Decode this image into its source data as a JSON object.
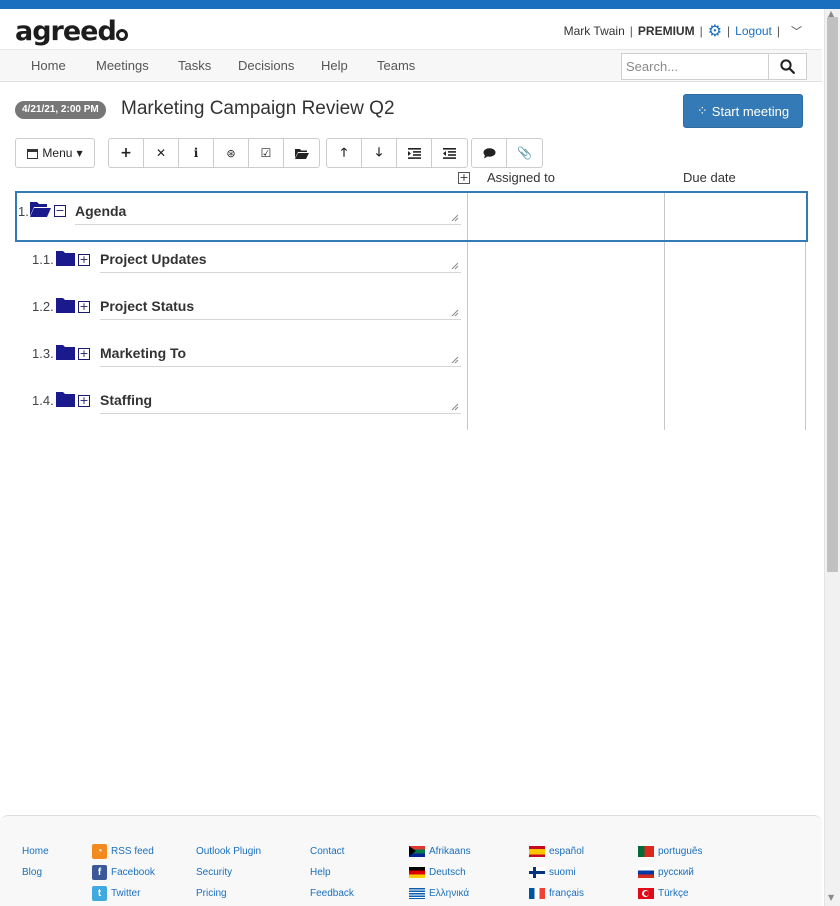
{
  "brand": {
    "logo_text_a": "agreed",
    "logo_text_b": ""
  },
  "user": {
    "name": "Mark Twain",
    "plan": "PREMIUM",
    "logout_label": "Logout",
    "sep": "|"
  },
  "nav": {
    "items": [
      "Home",
      "Meetings",
      "Tasks",
      "Decisions",
      "Help",
      "Teams"
    ],
    "search_placeholder": "Search..."
  },
  "meeting": {
    "date_badge": "4/21/21, 2:00 PM",
    "title": "Marketing Campaign Review Q2",
    "start_label": "Start meeting"
  },
  "toolbar": {
    "menu_label": "Menu"
  },
  "columns": {
    "assigned_to": "Assigned to",
    "due_date": "Due date"
  },
  "agenda": [
    {
      "num": "1.",
      "title": "Agenda",
      "expander": "−",
      "open": true
    },
    {
      "num": "1.1.",
      "title": "Project Updates",
      "expander": "+"
    },
    {
      "num": "1.2.",
      "title": "Project Status",
      "expander": "+"
    },
    {
      "num": "1.3.",
      "title": "Marketing To",
      "expander": "+"
    },
    {
      "num": "1.4.",
      "title": "Staffing",
      "expander": "+"
    }
  ],
  "footer": {
    "col1": [
      "Home",
      "Blog"
    ],
    "col2": [
      "RSS feed",
      "Facebook",
      "Twitter"
    ],
    "col3": [
      "Outlook Plugin",
      "Security",
      "Pricing"
    ],
    "col4": [
      "Contact",
      "Help",
      "Feedback"
    ],
    "col5": [
      "Afrikaans",
      "Deutsch",
      "Ελληνικά"
    ],
    "col6": [
      "español",
      "suomi",
      "français"
    ],
    "col7": [
      "português",
      "русский",
      "Türkçe"
    ]
  },
  "colors": {
    "accent": "#1a6fbf",
    "button": "#337ab7",
    "folder": "#1a1a8c"
  },
  "icons": [
    "gear-icon",
    "search-icon",
    "spinner-icon",
    "calendar-icon",
    "plus-icon",
    "close-icon",
    "info-icon",
    "handshake-icon",
    "checkbox-icon",
    "folder-open-icon",
    "arrow-up-icon",
    "arrow-down-icon",
    "indent-icon",
    "outdent-icon",
    "comment-icon",
    "paperclip-icon",
    "folder-icon"
  ]
}
